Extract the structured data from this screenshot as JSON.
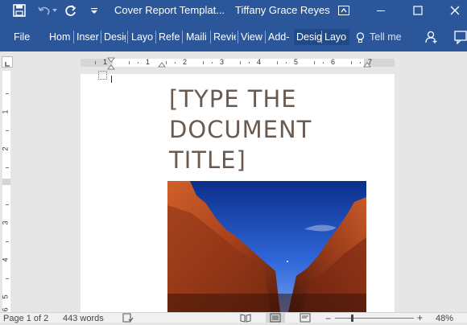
{
  "titlebar": {
    "doc_title": "Cover Report Templat...",
    "user_name": "Tiffany Grace Reyes"
  },
  "ribbon": {
    "tabs": [
      {
        "label": "File"
      },
      {
        "label": "Hom"
      },
      {
        "label": "Inser"
      },
      {
        "label": "Desig"
      },
      {
        "label": "Layo"
      },
      {
        "label": "Refe"
      },
      {
        "label": "Maili"
      },
      {
        "label": "Revie"
      },
      {
        "label": "View"
      },
      {
        "label": "Add-"
      },
      {
        "label": "Desig"
      },
      {
        "label": "Layo"
      }
    ],
    "tell_me": "Tell me"
  },
  "ruler": {
    "h_numbers": [
      "1",
      "1",
      "2",
      "3",
      "4",
      "5",
      "6",
      "7"
    ],
    "v_numbers": [
      "1",
      "2",
      "3",
      "4",
      "5",
      "6"
    ]
  },
  "document": {
    "title_lines": [
      "[TYPE THE",
      "DOCUMENT",
      "TITLE]"
    ]
  },
  "status": {
    "page": "Page 1 of 2",
    "words": "443 words",
    "zoom": "48%"
  },
  "colors": {
    "word_blue": "#2b579a",
    "title_brown": "#6b5a50"
  }
}
